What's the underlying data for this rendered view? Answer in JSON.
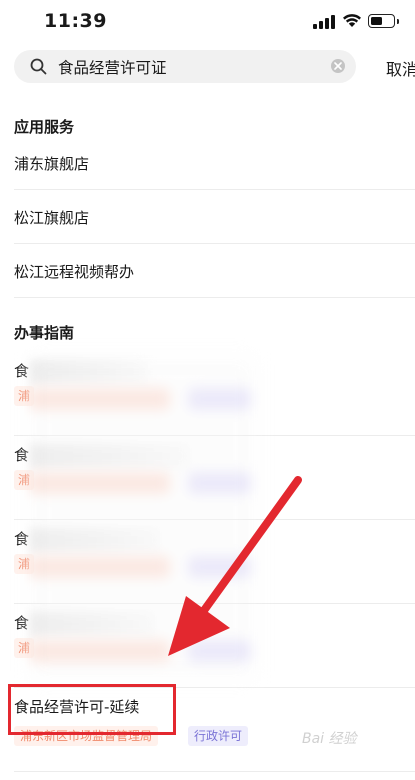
{
  "status_bar": {
    "time": "11:39"
  },
  "search": {
    "query": "食品经营许可证",
    "cancel_label": "取消"
  },
  "sections": {
    "services_title": "应用服务",
    "guides_title": "办事指南"
  },
  "services": [
    {
      "label": "浦东旗舰店"
    },
    {
      "label": "松江旗舰店"
    },
    {
      "label": "松江远程视频帮办"
    }
  ],
  "guides": [
    {
      "title": "食",
      "org": "浦",
      "type": ""
    },
    {
      "title": "食",
      "org": "浦",
      "type": ""
    },
    {
      "title": "食",
      "org": "浦",
      "type": ""
    },
    {
      "title": "食",
      "org": "浦",
      "type": ""
    },
    {
      "title": "食品经营许可-延续",
      "org": "浦东新区市场监督管理局",
      "type": "行政许可"
    }
  ],
  "watermark": "Bai 经验",
  "colors": {
    "highlight": "#e3282f",
    "org_tag": "#f08a6b",
    "type_tag": "#7b74d6"
  }
}
